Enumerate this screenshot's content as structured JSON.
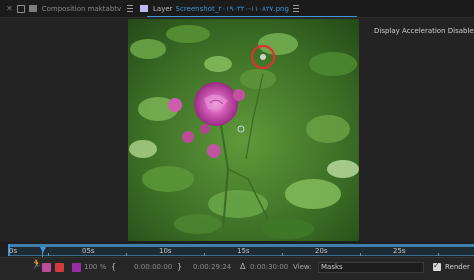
{
  "tabs": {
    "composition_label": "Composition maktabtv",
    "layer_prefix": "Layer",
    "layer_file": "Screenshot_۲۰۱۹۰۳۲۰-۱۱۰۸۲۷.png"
  },
  "viewer_notice": "Display Acceleration Disabled",
  "timeline": {
    "ticks": [
      "0s",
      "05s",
      "10s",
      "15s",
      "20s",
      "25s"
    ]
  },
  "controls": {
    "zoom_pct": "100 %",
    "timecode_in": "0:00:00:00",
    "timecode_out": "0:00:29:24",
    "timecode_dur": "0:00:30:00",
    "view_label": "View:",
    "view_value": "Masks",
    "render_label": "Render"
  },
  "colors": {
    "accent": "#3f95d6",
    "background": "#232323"
  }
}
